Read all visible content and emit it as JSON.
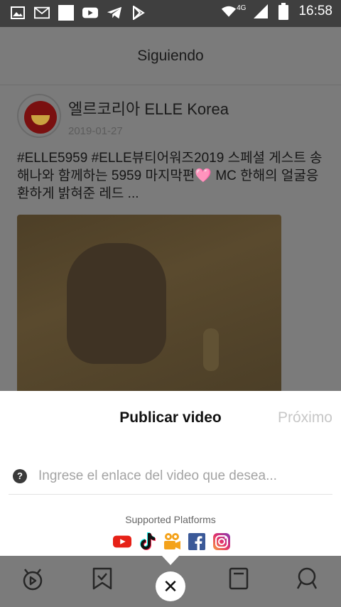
{
  "status_bar": {
    "network": "4G",
    "time": "16:58",
    "left_icons": [
      "gallery-icon",
      "gmail-icon",
      "blank-square-icon",
      "youtube-icon",
      "telegram-icon",
      "play-store-icon"
    ]
  },
  "page": {
    "title": "Siguiendo",
    "post": {
      "author": "엘르코리아 ELLE Korea",
      "date": "2019-01-27",
      "text": "#ELLE5959 #ELLE뷰티어워즈2019  스페셜 게스트 송해나와 함께하는 5959 마지막편🩷 MC 한해의 얼굴응 환하게 밝혀준 레드 ..."
    }
  },
  "sheet": {
    "title": "Publicar video",
    "next_label": "Próximo",
    "help_glyph": "?",
    "link_placeholder": "Ingrese el enlace del video que desea...",
    "platforms_label": "Supported Platforms",
    "platforms": [
      "YouTube",
      "TikTok",
      "Kuaishou",
      "Facebook",
      "Instagram"
    ]
  },
  "bottom_nav": {
    "close_glyph": "✕",
    "items": [
      "home-icon",
      "bookmark-icon",
      "close-icon",
      "notes-icon",
      "search-icon"
    ]
  },
  "colors": {
    "overlay": "#7b7b7b",
    "youtube": "#e62117",
    "tiktok": "#111111",
    "kuaishou": "#f4a21b",
    "facebook": "#3b5998",
    "instagram": "#c13584"
  }
}
